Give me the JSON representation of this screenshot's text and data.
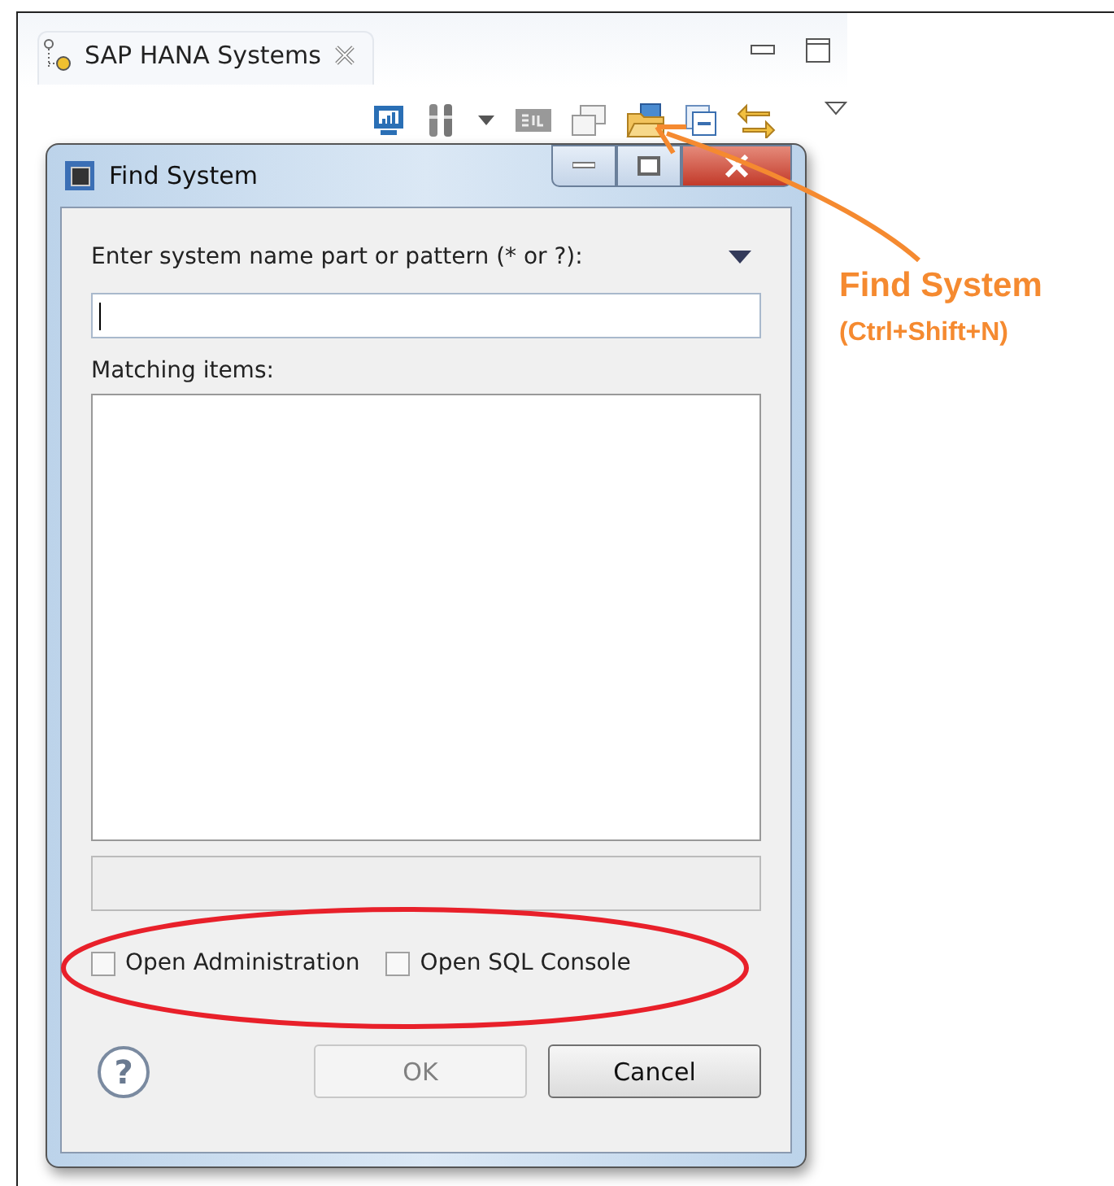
{
  "view": {
    "tab_title": "SAP HANA Systems"
  },
  "dialog": {
    "title": "Find System",
    "pattern_label": "Enter system name part or pattern (* or ?):",
    "matching_label": "Matching items:",
    "options": [
      {
        "label": "Open Administration",
        "checked": false
      },
      {
        "label": "Open SQL Console",
        "checked": false
      }
    ],
    "buttons": [
      {
        "label": "OK",
        "disabled": true
      },
      {
        "label": "Cancel",
        "disabled": false
      }
    ],
    "help_glyph": "?"
  },
  "annotation": {
    "title": "Find System",
    "shortcut": "(Ctrl+Shift+N)"
  }
}
